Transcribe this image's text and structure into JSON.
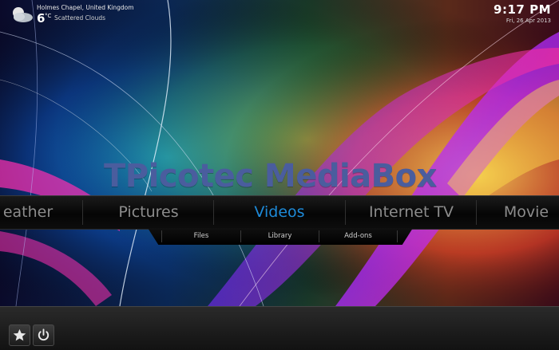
{
  "weather": {
    "location": "Holmes Chapel, United Kingdom",
    "temperature": "6",
    "unit": "°C",
    "condition": "Scattered Clouds",
    "icon": "partly-cloudy-icon"
  },
  "clock": {
    "time": "9:17 PM",
    "date": "Fri, 26 Apr 2013"
  },
  "logo": "TPicotec MediaBox",
  "main_menu": {
    "items": [
      {
        "label": "eather"
      },
      {
        "label": "Pictures"
      },
      {
        "label": "Videos",
        "active": true
      },
      {
        "label": "Internet TV"
      },
      {
        "label": "Movie"
      }
    ],
    "active_color": "#1e8ad8"
  },
  "sub_menu": {
    "items": [
      {
        "label": "Files"
      },
      {
        "label": "Library"
      },
      {
        "label": "Add-ons"
      }
    ]
  },
  "bottom_bar": {
    "buttons": [
      {
        "name": "favourites",
        "icon": "star-icon"
      },
      {
        "name": "power",
        "icon": "power-icon"
      }
    ]
  }
}
